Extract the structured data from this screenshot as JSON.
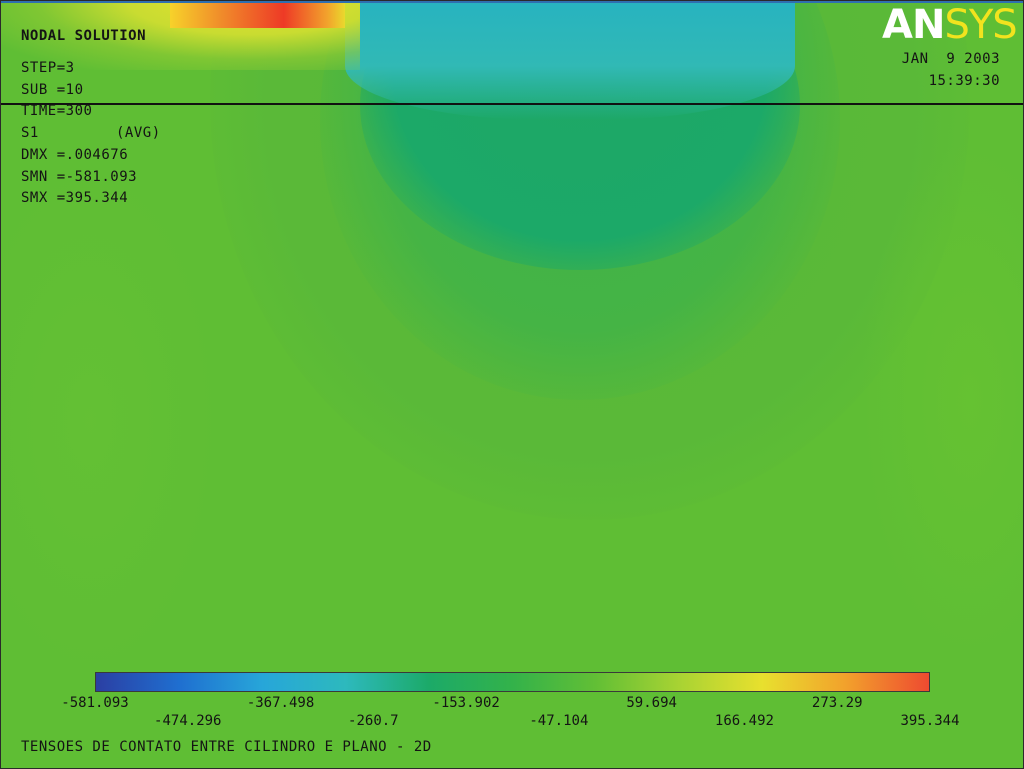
{
  "header": {
    "title": "NODAL SOLUTION",
    "step": "STEP=3",
    "sub": "SUB =10",
    "time": "TIME=300",
    "result": "S1",
    "avg": "(AVG)",
    "dmx": "DMX =.004676",
    "smn": "SMN =-581.093",
    "smx": "SMX =395.344"
  },
  "branding": {
    "logo_an": "AN",
    "logo_sys": "SYS",
    "date": "JAN  9 2003",
    "time": "15:39:30"
  },
  "legend": {
    "colors": [
      "#2b3fa3",
      "#1f6fd0",
      "#27a6d9",
      "#2db9bd",
      "#1caa68",
      "#33b24a",
      "#62bf35",
      "#a8d333",
      "#e8e02e",
      "#f2a12c",
      "#ee4a30"
    ],
    "ticks_row1": [
      "-581.093",
      "-367.498",
      "-153.902",
      "59.694",
      "273.29"
    ],
    "ticks_row2": [
      "-474.296",
      "-260.7",
      "-47.104",
      "166.492",
      "395.344"
    ]
  },
  "caption": "TENSOES DE CONTATO ENTRE CILINDRO E PLANO - 2D",
  "colors": {
    "background": "#5fbe34",
    "contact_zone": "#27b3c0",
    "hot_spot": "#ee3a26"
  }
}
